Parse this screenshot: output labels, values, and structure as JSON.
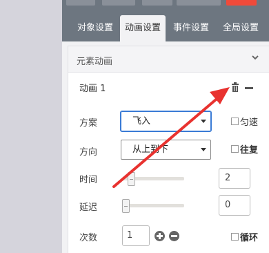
{
  "tabs": [
    {
      "label": "对象设置"
    },
    {
      "label": "动画设置"
    },
    {
      "label": "事件设置"
    },
    {
      "label": "全局设置"
    }
  ],
  "card": {
    "title": "元素动画",
    "animation_name": "动画 1"
  },
  "form": {
    "scheme_label": "方案",
    "scheme_value": "飞入",
    "direction_label": "方向",
    "direction_value": "从上到下",
    "time_label": "时间",
    "time_value": "2",
    "delay_label": "延迟",
    "delay_value": "0",
    "count_label": "次数",
    "count_value": "1",
    "uniform_label": "匀速",
    "reverse_label": "往复",
    "loop_label": "循环"
  },
  "colors": {
    "tab_bar": "#6d7680",
    "active_tab": "#f2f2f4",
    "arrow": "#e8322f",
    "top_red_button": "#f04a3a"
  },
  "icons": {
    "chevron": "chevron-down-icon",
    "trash": "trash-icon",
    "collapse": "minus-icon",
    "plus": "plus-circle-icon",
    "minus": "minus-circle-icon"
  }
}
